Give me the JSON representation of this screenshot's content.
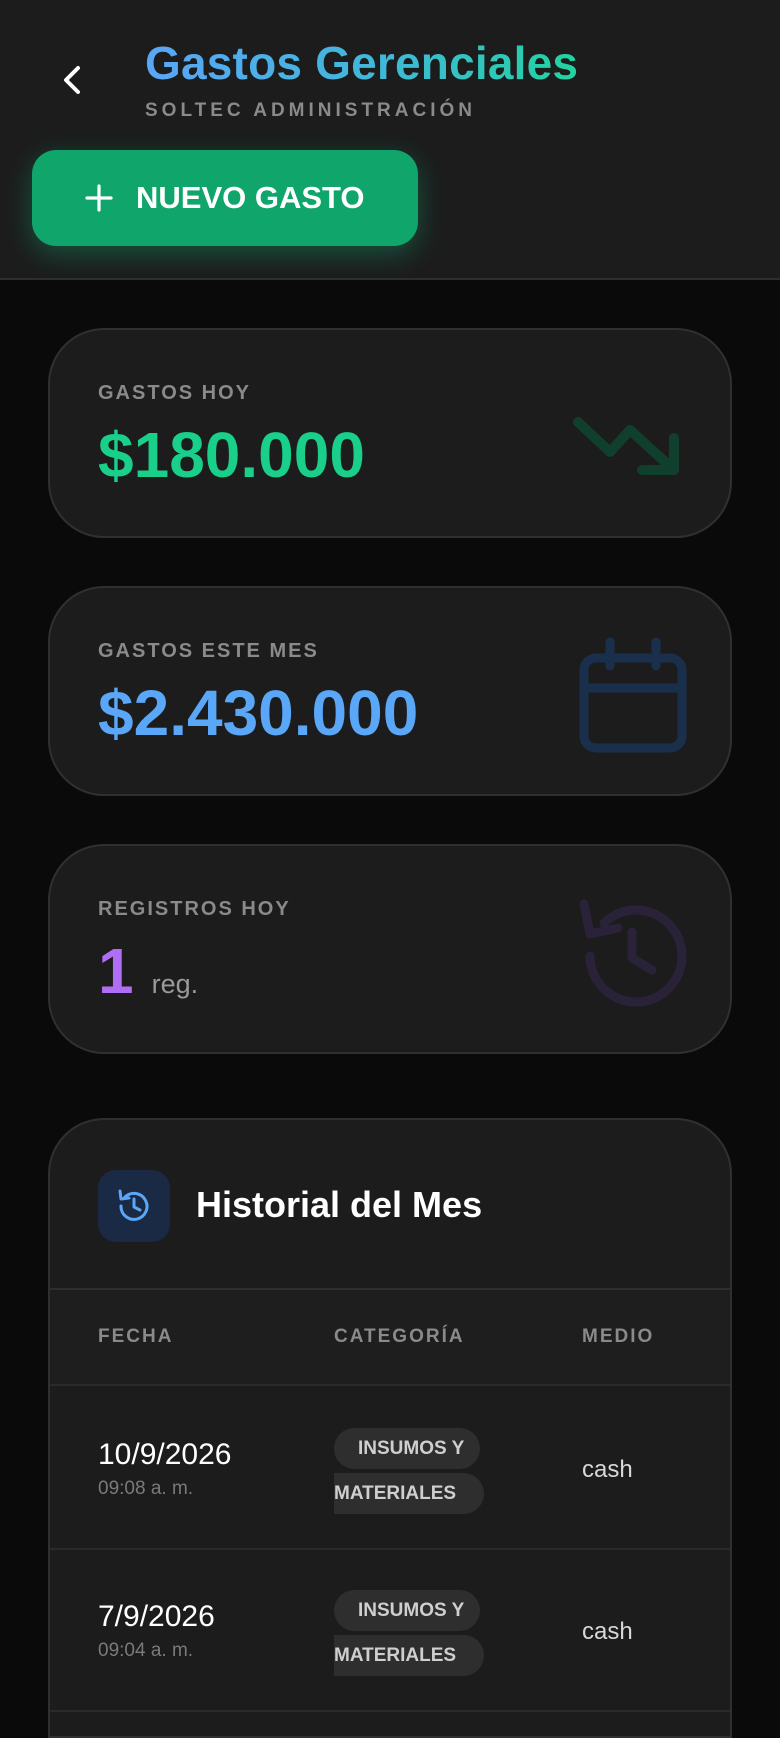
{
  "header": {
    "title": "Gastos Gerenciales",
    "subtitle": "SOLTEC ADMINISTRACIÓN",
    "new_button_label": "NUEVO GASTO"
  },
  "stats": [
    {
      "label": "GASTOS HOY",
      "value": "$180.000",
      "icon": "trending-down-icon",
      "color": "#19cf8a"
    },
    {
      "label": "GASTOS ESTE MES",
      "value": "$2.430.000",
      "icon": "calendar-icon",
      "color": "#5aa6f7"
    },
    {
      "label": "REGISTROS HOY",
      "value": "1",
      "unit": "reg.",
      "icon": "history-icon",
      "color": "#b06ef5"
    }
  ],
  "history": {
    "title": "Historial del Mes",
    "icon": "history-icon",
    "columns": [
      "FECHA",
      "CATEGORÍA",
      "MEDIO"
    ],
    "rows": [
      {
        "date": "10/9/2026",
        "time": "09:08 a. m.",
        "category_line1": "INSUMOS Y",
        "category_line2": "MATERIALES",
        "medio": "cash"
      },
      {
        "date": "7/9/2026",
        "time": "09:04 a. m.",
        "category_line1": "INSUMOS Y",
        "category_line2": "MATERIALES",
        "medio": "cash"
      }
    ]
  },
  "colors": {
    "accent_green": "#0fa56b",
    "accent_blue": "#5aa6f7",
    "accent_purple": "#b06ef5",
    "background": "#0a0a0a",
    "card": "#1c1c1c"
  }
}
